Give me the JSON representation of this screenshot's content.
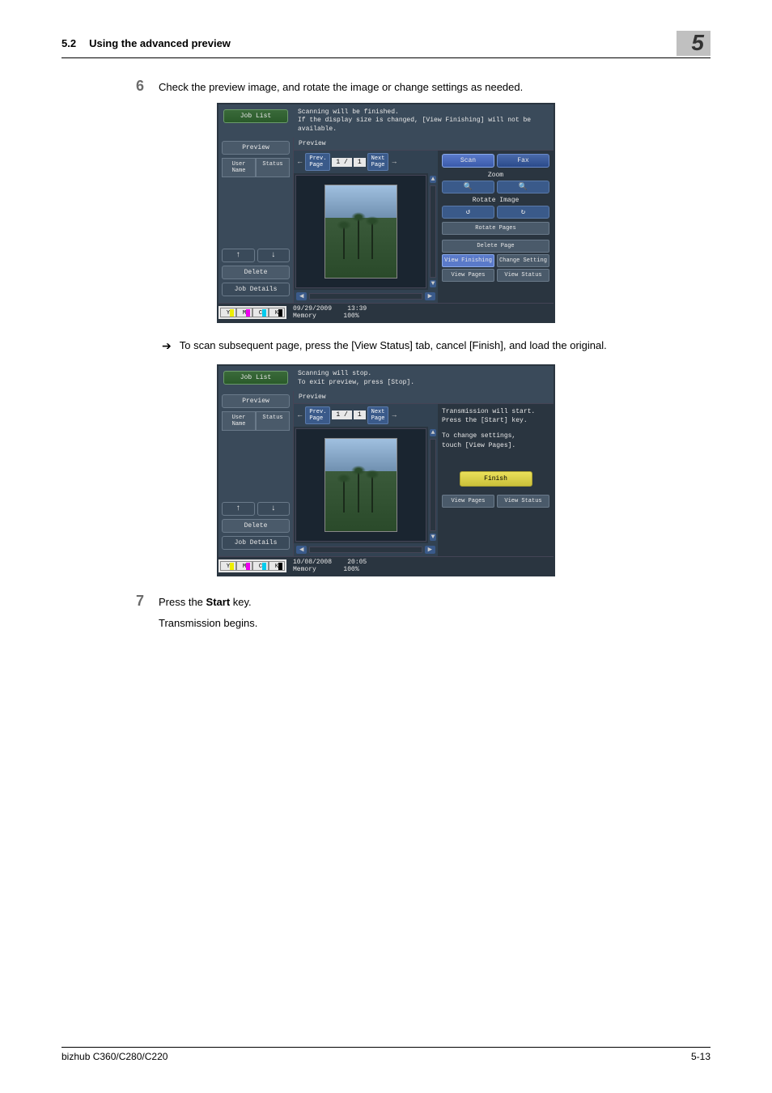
{
  "header": {
    "section_num": "5.2",
    "section_title": "Using the advanced preview",
    "chapter": "5"
  },
  "steps": {
    "six": {
      "num": "6",
      "text": "Check the preview image, and rotate the image or change settings as needed."
    },
    "bullet": {
      "arrow": "➔",
      "text": "To scan subsequent page, press the [View Status] tab, cancel [Finish], and load the original."
    },
    "seven": {
      "num": "7",
      "line1": "Press the ",
      "bold": "Start",
      "line1b": " key.",
      "line2": "Transmission begins."
    }
  },
  "ss1": {
    "joblist": "Job List",
    "msg1": "Scanning will be finished.",
    "msg2": "If the display size is changed, [View Finishing] will not be available.",
    "preview_btn": "Preview",
    "user_tab": "User\nName",
    "status_tab": "Status",
    "delete": "Delete",
    "jobdetails": "Job Details",
    "preview_hdr": "Preview",
    "prevpage": "Prev.\nPage",
    "pagenum": "1 /",
    "pagetot": "1",
    "nextpage": "Next\nPage",
    "scan_tab": "Scan",
    "fax_tab": "Fax",
    "zoom": "Zoom",
    "zin": "🔍",
    "zout": "🔍",
    "rotimg": "Rotate Image",
    "rl": "↺",
    "rr": "↻",
    "rotpages": "Rotate Pages",
    "delpage": "Delete Page",
    "viewfin": "View Finishing",
    "chgset": "Change Setting",
    "viewpages": "View Pages",
    "viewstatus": "View Status",
    "date": "09/29/2009",
    "time": "13:39",
    "mem": "Memory",
    "memv": "100%"
  },
  "ss2": {
    "joblist": "Job List",
    "msg1": "Scanning will stop.",
    "msg2": "To exit preview, press [Stop].",
    "preview_btn": "Preview",
    "user_tab": "User\nName",
    "status_tab": "Status",
    "delete": "Delete",
    "jobdetails": "Job Details",
    "preview_hdr": "Preview",
    "prevpage": "Prev.\nPage",
    "pagenum": "1 /",
    "pagetot": "1",
    "nextpage": "Next\nPage",
    "rtext1": "Transmission will start.\nPress the [Start] key.",
    "rtext2": "To change settings,\ntouch [View Pages].",
    "finish": "Finish",
    "viewpages": "View Pages",
    "viewstatus": "View Status",
    "date": "10/08/2008",
    "time": "20:05",
    "mem": "Memory",
    "memv": "100%"
  },
  "toner": {
    "y": "Y",
    "m": "M",
    "c": "C",
    "k": "K"
  },
  "footer": {
    "left": "bizhub C360/C280/C220",
    "right": "5-13"
  }
}
